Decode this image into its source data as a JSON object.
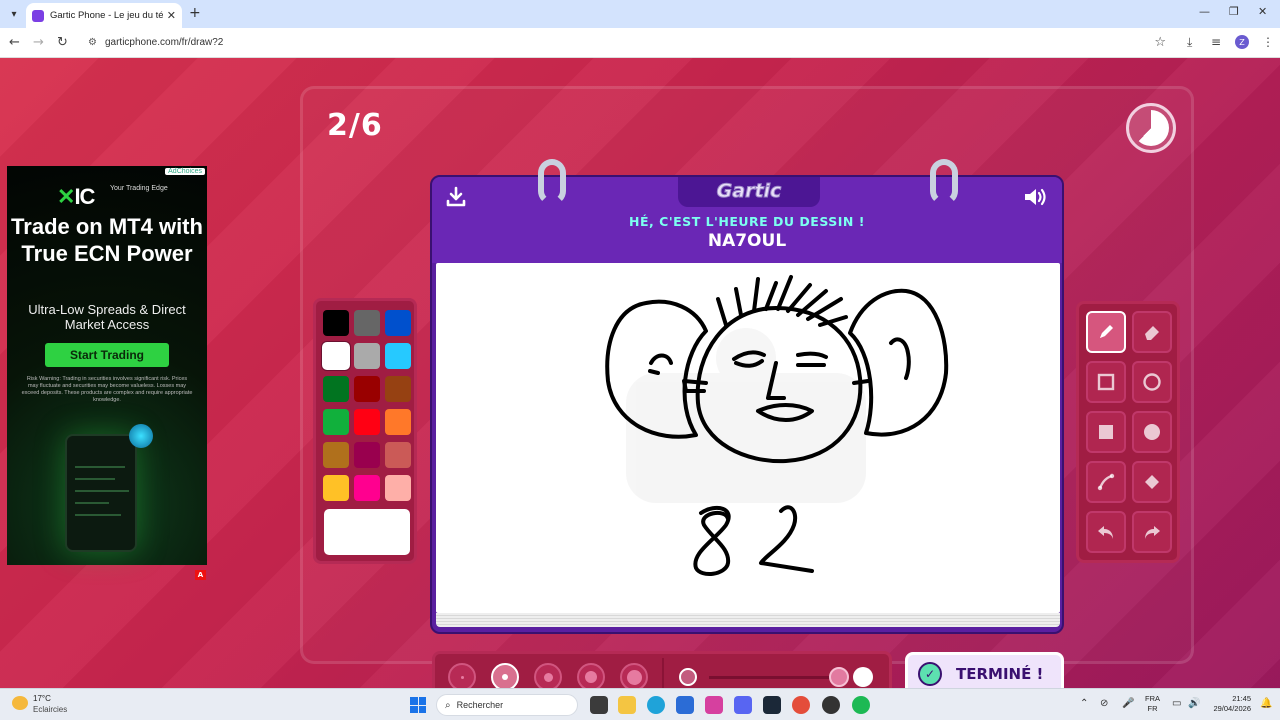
{
  "browser": {
    "tab_title": "Gartic Phone - Le jeu du téléph",
    "url": "garticphone.com/fr/draw?2",
    "profile_initial": "Z"
  },
  "game": {
    "round": "2/6",
    "logo": "Gartic",
    "prompt": "HÉ, C'EST L'HEURE DU DESSIN !",
    "player": "NA7OUL",
    "done_label": "TERMINÉ !",
    "timer_fraction_elapsed": 0.62,
    "colors": {
      "accent": "#5a1fa0",
      "prompt": "#7dfff0",
      "background": "#c8284d"
    },
    "palette": [
      "#000000",
      "#666666",
      "#0050cd",
      "#ffffff",
      "#aaaaaa",
      "#26c9ff",
      "#017420",
      "#990000",
      "#964112",
      "#11b03c",
      "#ff0013",
      "#ff7829",
      "#b0701c",
      "#99004e",
      "#cb5a57",
      "#ffc126",
      "#ff008f",
      "#feafa8"
    ],
    "selected_color": "#ffffff",
    "brush_sizes": [
      "size-1",
      "size-2",
      "size-3",
      "size-4",
      "size-5"
    ],
    "selected_brush_size_index": 1,
    "opacity_fraction": 1.0,
    "tools": [
      {
        "name": "pen-tool",
        "icon": "pencil-icon",
        "active": true
      },
      {
        "name": "eraser-tool",
        "icon": "eraser-icon",
        "active": false
      },
      {
        "name": "rectangle-outline-tool",
        "icon": "square-outline-icon",
        "active": false
      },
      {
        "name": "ellipse-outline-tool",
        "icon": "circle-outline-icon",
        "active": false
      },
      {
        "name": "rectangle-fill-tool",
        "icon": "square-filled-icon",
        "active": false
      },
      {
        "name": "ellipse-fill-tool",
        "icon": "circle-filled-icon",
        "active": false
      },
      {
        "name": "line-tool",
        "icon": "line-icon",
        "active": false
      },
      {
        "name": "fill-tool",
        "icon": "bucket-icon",
        "active": false
      },
      {
        "name": "undo-tool",
        "icon": "undo-icon",
        "active": false
      },
      {
        "name": "redo-tool",
        "icon": "redo-icon",
        "active": false
      }
    ],
    "drawing_numbers": "82"
  },
  "ad": {
    "choices_label": "AdChoices",
    "logo": "IC",
    "tagline": "Your Trading Edge",
    "headline": "Trade on MT4 with True ECN Power",
    "subheadline": "Ultra-Low Spreads & Direct Market Access",
    "cta": "Start Trading",
    "risk": "Risk Warning: Trading in securities involves significant risk. Prices may fluctuate and securities may become valueless. Losses may exceed deposits. These products are complex and require appropriate knowledge.",
    "badge": "A"
  },
  "taskbar": {
    "temperature": "17°C",
    "weather": "Eclaircies",
    "search_placeholder": "Rechercher",
    "lang_top": "FRA",
    "lang_bottom": "FR",
    "time": "21:45",
    "date": "29/04/2026"
  }
}
